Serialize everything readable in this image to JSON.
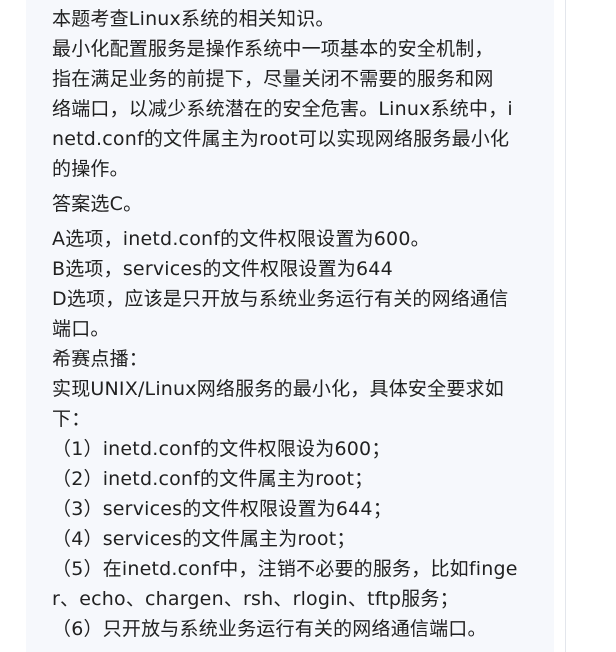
{
  "content": {
    "intro": "本题考查Linux系统的相关知识。",
    "explanation": [
      "最小化配置服务是操作系统中一项基本的安全机制，",
      "指在满足业务的前提下，尽量关闭不需要的服务和网",
      "络端口，以减少系统潜在的安全危害。Linux系统中，i",
      "netd.conf的文件属主为root可以实现网络服务最小化",
      "的操作。"
    ],
    "answer": "答案选C。",
    "options": [
      "A选项，inetd.conf的文件权限设置为600。",
      "B选项，services的文件权限设置为644",
      "D选项，应该是只开放与系统业务运行有关的网络通信",
      "端口。"
    ],
    "tip_title": "希赛点播：",
    "tip_intro": [
      "实现UNIX/Linux网络服务的最小化，具体安全要求如",
      "下："
    ],
    "requirements": [
      "（1）inetd.conf的文件权限设为600；",
      "（2）inetd.conf的文件属主为root；",
      "（3）services的文件权限设置为644；",
      "（4）services的文件属主为root；",
      "（5）在inetd.conf中，注销不必要的服务，比如finge",
      "r、echo、chargen、rsh、rlogin、tftp服务；",
      "（6）只开放与系统业务运行有关的网络通信端口。"
    ]
  }
}
